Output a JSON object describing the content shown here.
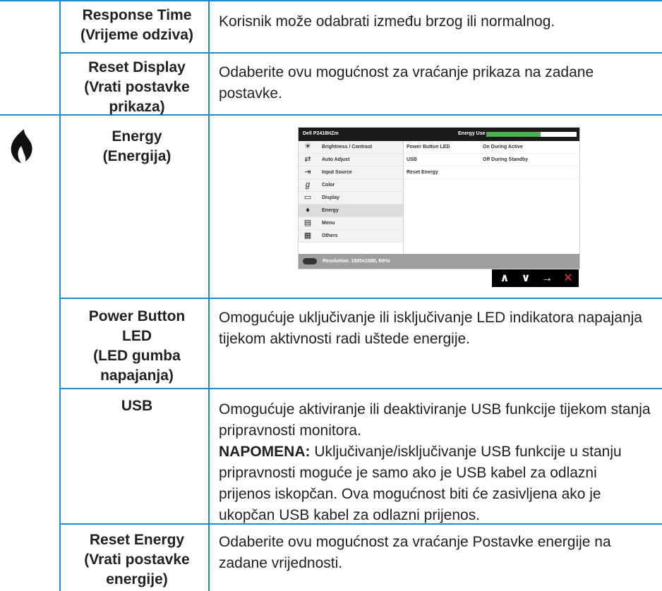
{
  "rows": [
    {
      "label": "Response Time\n(Vrijeme odziva)",
      "desc": "Korisnik može odabrati između brzog ili normalnog."
    },
    {
      "label": "Reset Display\n(Vrati postavke\nprikaza)",
      "desc": "Odaberite ovu mogućnost za vraćanje prikaza na zadane postavke."
    },
    {
      "label": "Energy\n(Energija)"
    },
    {
      "label": "Power Button\nLED\n(LED gumba\nnapajanja)",
      "desc": "Omogućuje uključivanje ili isključivanje LED indikatora napajanja tijekom aktivnosti radi uštede energije."
    },
    {
      "label": "USB",
      "desc": "Omogućuje aktiviranje ili deaktiviranje USB funkcije tijekom stanja pripravnosti monitora."
    },
    {
      "label": "Reset Energy\n(Vrati postavke\nenergije)",
      "desc": "Odaberite ovu mogućnost za vraćanje Postavke energije na zadane vrijednosti."
    }
  ],
  "note": {
    "prefix": "NAPOMENA:",
    "text": " Uključivanje/isključivanje USB funkcije u stanju pripravnosti moguće je samo ako je USB kabel za odlazni prijenos iskopčan. Ova mogućnost biti će zasivljena ako je ukopčan USB kabel za odlazni prijenos."
  },
  "osd": {
    "model": "Dell P2418HZm",
    "energy_use_label": "Energy Use",
    "energy_level": 0.6,
    "menu": [
      {
        "icon": "brightness-icon",
        "glyph": "☀",
        "label": "Brightness / Contrast"
      },
      {
        "icon": "auto-adjust-icon",
        "glyph": "⇄",
        "label": "Auto Adjust"
      },
      {
        "icon": "input-source-icon",
        "glyph": "⇥",
        "label": "Input Source"
      },
      {
        "icon": "color-icon",
        "glyph": "ℊ",
        "label": "Color"
      },
      {
        "icon": "display-icon",
        "glyph": "▭",
        "label": "Display"
      },
      {
        "icon": "energy-icon",
        "glyph": "♦",
        "label": "Energy"
      },
      {
        "icon": "menu-icon",
        "glyph": "▤",
        "label": "Menu"
      },
      {
        "icon": "others-icon",
        "glyph": "▦",
        "label": "Others"
      }
    ],
    "settings": [
      {
        "name": "Power Button LED",
        "value": "On During Active"
      },
      {
        "name": "USB",
        "value": "Off During Standby"
      },
      {
        "name": "Reset Energy",
        "value": ""
      }
    ],
    "resolution": "Resolution: 1920x1080, 60Hz",
    "nav": [
      "∧",
      "∨",
      "→",
      "✕"
    ]
  },
  "colors": {
    "rule": "#1f8bd0",
    "text": "#231f20"
  }
}
